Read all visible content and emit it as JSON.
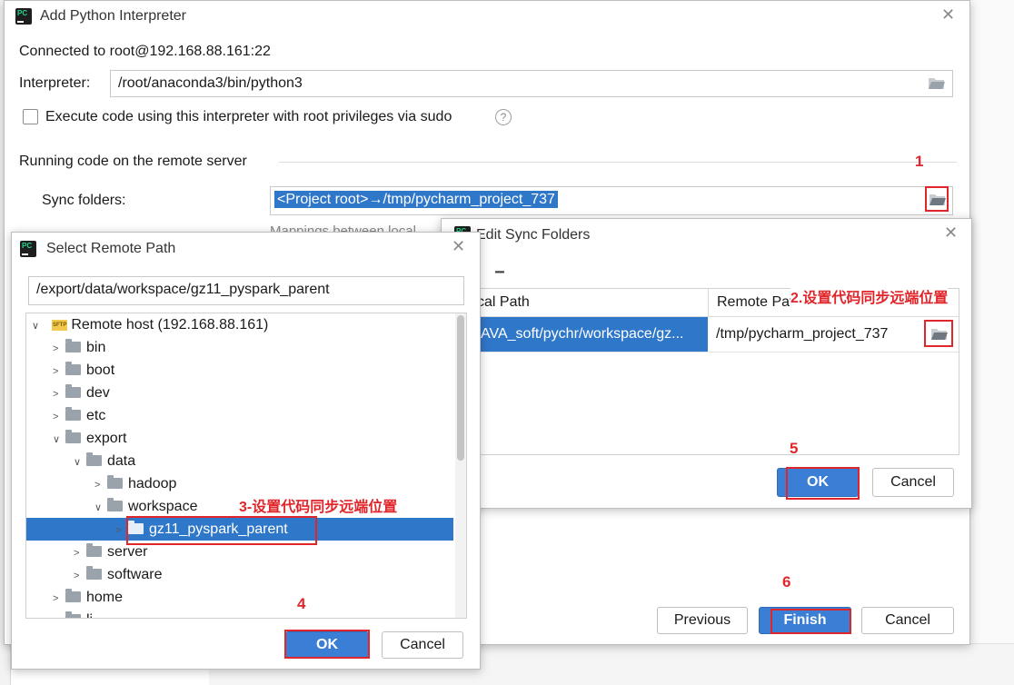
{
  "main_dialog": {
    "title": "Add Python Interpreter",
    "connected": "Connected to root@192.168.88.161:22",
    "interpreter_label": "Interpreter:",
    "interpreter_value": "/root/anaconda3/bin/python3",
    "sudo_label": "Execute code using this interpreter with root privileges via sudo",
    "section_title": "Running code on the remote server",
    "sync_label": "Sync folders:",
    "sync_value": "<Project root>→/tmp/pycharm_project_737",
    "mappings_partial": "Mappings between local",
    "previous": "Previous",
    "finish": "Finish",
    "cancel": "Cancel"
  },
  "sync_dialog": {
    "title": "Edit Sync Folders",
    "minus": "−",
    "col_local": "cal Path",
    "col_remote": "Remote Path",
    "local_value": "AVA_soft/pychr/workspace/gz...",
    "remote_value": "/tmp/pycharm_project_737",
    "ok": "OK",
    "cancel": "Cancel"
  },
  "remote_dialog": {
    "title": "Select Remote Path",
    "path": "/export/data/workspace/gz11_pyspark_parent",
    "sftp_badge": "SFTP",
    "tree": [
      {
        "label": "Remote host (192.168.88.161)",
        "chev": "∨",
        "level": 0,
        "root": true
      },
      {
        "label": "bin",
        "chev": ">",
        "level": 1
      },
      {
        "label": "boot",
        "chev": ">",
        "level": 1
      },
      {
        "label": "dev",
        "chev": ">",
        "level": 1
      },
      {
        "label": "etc",
        "chev": ">",
        "level": 1
      },
      {
        "label": "export",
        "chev": "∨",
        "level": 1
      },
      {
        "label": "data",
        "chev": "∨",
        "level": 2
      },
      {
        "label": "hadoop",
        "chev": ">",
        "level": 3
      },
      {
        "label": "workspace",
        "chev": "∨",
        "level": 3
      },
      {
        "label": "gz11_pyspark_parent",
        "chev": ">",
        "level": 4,
        "selected": true
      },
      {
        "label": "server",
        "chev": ">",
        "level": 2
      },
      {
        "label": "software",
        "chev": ">",
        "level": 2
      },
      {
        "label": "home",
        "chev": ">",
        "level": 1
      },
      {
        "label": "li",
        "chev": ">",
        "level": 1
      }
    ],
    "ok": "OK",
    "cancel": "Cancel"
  },
  "annotations": {
    "n1": "1",
    "n2": "2.设置代码同步远端位置",
    "n3": "3-设置代码同步远端位置",
    "n4": "4",
    "n5": "5",
    "n6": "6"
  },
  "colors": {
    "accent": "#3a7fd5",
    "selection": "#2f77c9",
    "annotation": "#e0262a"
  }
}
